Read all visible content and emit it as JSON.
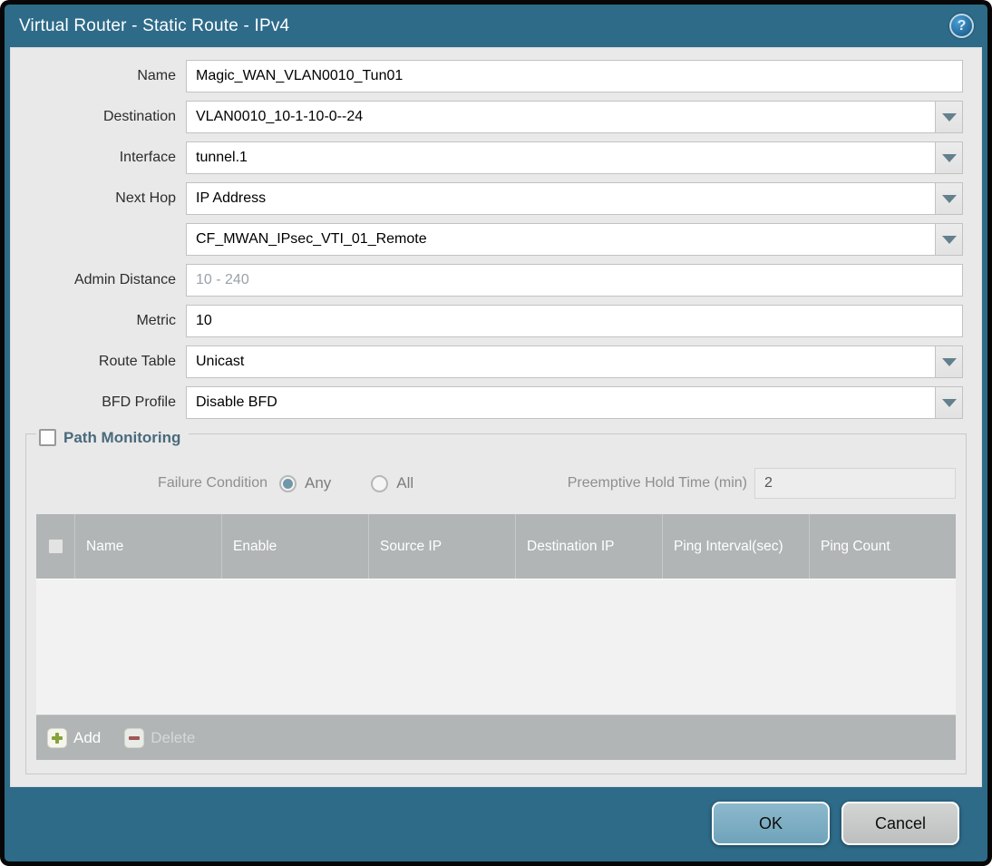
{
  "window": {
    "title": "Virtual Router - Static Route - IPv4"
  },
  "icons": {
    "help": "?"
  },
  "colors": {
    "frame_teal": "#2e6b89",
    "panel_gray": "#e9e9e9",
    "table_header_gray": "#b1b5b5",
    "ok_button_blue": "#7fafc4",
    "cancel_button_gray": "#c8caca",
    "add_icon_green": "#85a33b",
    "delete_icon_red": "#a05858",
    "radio_selected_teal": "#6f98aa"
  },
  "form": {
    "name": {
      "label": "Name",
      "value": "Magic_WAN_VLAN0010_Tun01"
    },
    "destination": {
      "label": "Destination",
      "value": "VLAN0010_10-1-10-0--24"
    },
    "interface": {
      "label": "Interface",
      "value": "tunnel.1"
    },
    "next_hop": {
      "label": "Next Hop",
      "value": "IP Address"
    },
    "next_hop_address": {
      "value": "CF_MWAN_IPsec_VTI_01_Remote"
    },
    "admin_distance": {
      "label": "Admin Distance",
      "placeholder": "10 - 240"
    },
    "metric": {
      "label": "Metric",
      "value": "10"
    },
    "route_table": {
      "label": "Route Table",
      "value": "Unicast"
    },
    "bfd_profile": {
      "label": "BFD Profile",
      "value": "Disable BFD"
    }
  },
  "path_monitoring": {
    "title": "Path Monitoring",
    "checkbox_checked": false,
    "failure_condition_label": "Failure Condition",
    "any_label": "Any",
    "all_label": "All",
    "failure_condition_selected": "Any",
    "preemptive_label": "Preemptive Hold Time (min)",
    "preemptive_value": "2",
    "table": {
      "columns": [
        "Name",
        "Enable",
        "Source IP",
        "Destination IP",
        "Ping Interval(sec)",
        "Ping Count"
      ],
      "rows": []
    },
    "add_label": "Add",
    "delete_label": "Delete"
  },
  "footer": {
    "ok_label": "OK",
    "cancel_label": "Cancel"
  }
}
